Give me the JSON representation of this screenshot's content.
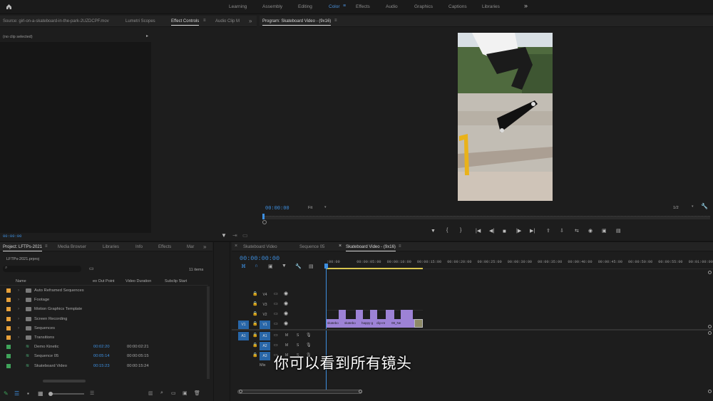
{
  "topbar": {
    "home_icon": "home-icon",
    "workspaces": [
      "Learning",
      "Assembly",
      "Editing",
      "Color",
      "Effects",
      "Audio",
      "Graphics",
      "Captions",
      "Libraries"
    ],
    "active_workspace": "Color",
    "more": "»"
  },
  "source_panel": {
    "tabs": [
      "Source: girl-on-a-skateboard-in-the-park-2UZDCPF.mov",
      "Lumetri Scopes",
      "Effect Controls",
      "Audio Clip M"
    ],
    "active_tab": "Effect Controls",
    "no_clip": "(no clip selected)",
    "timecode": "00:00:00"
  },
  "program_panel": {
    "title": "Program: Skateboard Video - (9x16)",
    "timecode": "00:00:00",
    "fit": "Fit",
    "resolution": "1/2"
  },
  "project_panel": {
    "tabs": [
      "Project: LFTPs-2021",
      "Media Browser",
      "Libraries",
      "Info",
      "Effects",
      "Mar"
    ],
    "active_tab": "Project: LFTPs-2021",
    "file": "LFTPs-2021.prproj",
    "items_count": "11 items",
    "columns": [
      "Name",
      "eo Out Point",
      "Video Duration",
      "Subclip Start"
    ],
    "items": [
      {
        "name": "Auto Reframed Sequences",
        "color": "#e8a13a",
        "type": "folder",
        "out": "",
        "duration": ""
      },
      {
        "name": "Footage",
        "color": "#e8a13a",
        "type": "folder",
        "out": "",
        "duration": ""
      },
      {
        "name": "Motion Graphics Template",
        "color": "#e8a13a",
        "type": "folder",
        "out": "",
        "duration": ""
      },
      {
        "name": "Screen Recording",
        "color": "#e8a13a",
        "type": "folder",
        "out": "",
        "duration": ""
      },
      {
        "name": "Sequences",
        "color": "#e8a13a",
        "type": "folder",
        "out": "",
        "duration": ""
      },
      {
        "name": "Transitions",
        "color": "#e8a13a",
        "type": "folder",
        "out": "",
        "duration": ""
      },
      {
        "name": "Demo Kinetic",
        "color": "#3fa35a",
        "type": "seq",
        "out": "00:02:20",
        "duration": "00:00:02:21"
      },
      {
        "name": "Sequence 05",
        "color": "#3fa35a",
        "type": "seq",
        "out": "00:05:14",
        "duration": "00:00:05:15"
      },
      {
        "name": "Skateboard Video",
        "color": "#3fa35a",
        "type": "seq",
        "out": "00:15:23",
        "duration": "00:00:15:24"
      }
    ]
  },
  "timeline": {
    "tabs": [
      "Skateboard Video",
      "Sequence 05",
      "Skateboard Video - (9x16)"
    ],
    "active_tab": "Skateboard Video - (9x16)",
    "timecode": "00:00:00:00",
    "ruler": [
      ":00:00",
      "00:00:05:00",
      "00:00:10:00",
      "00:00:15:00",
      "00:00:20:00",
      "00:00:25:00",
      "00:00:30:00",
      "00:00:35:00",
      "00:00:40:00",
      "00:00:45:00",
      "00:00:50:00",
      "00:00:55:00",
      "00:01:00:00"
    ],
    "video_tracks": [
      "V4",
      "V3",
      "V2",
      "V1"
    ],
    "audio_tracks": [
      "A1",
      "A2",
      "A3"
    ],
    "mix_label": "Mix",
    "source_patch_v": "V1",
    "source_patch_a": "A1",
    "clips": [
      "skatebo",
      "skatebo",
      "happy-g",
      "clip-re",
      "08_Ne"
    ],
    "mute": "M",
    "solo": "S"
  },
  "subtitle": "你可以看到所有镜头"
}
